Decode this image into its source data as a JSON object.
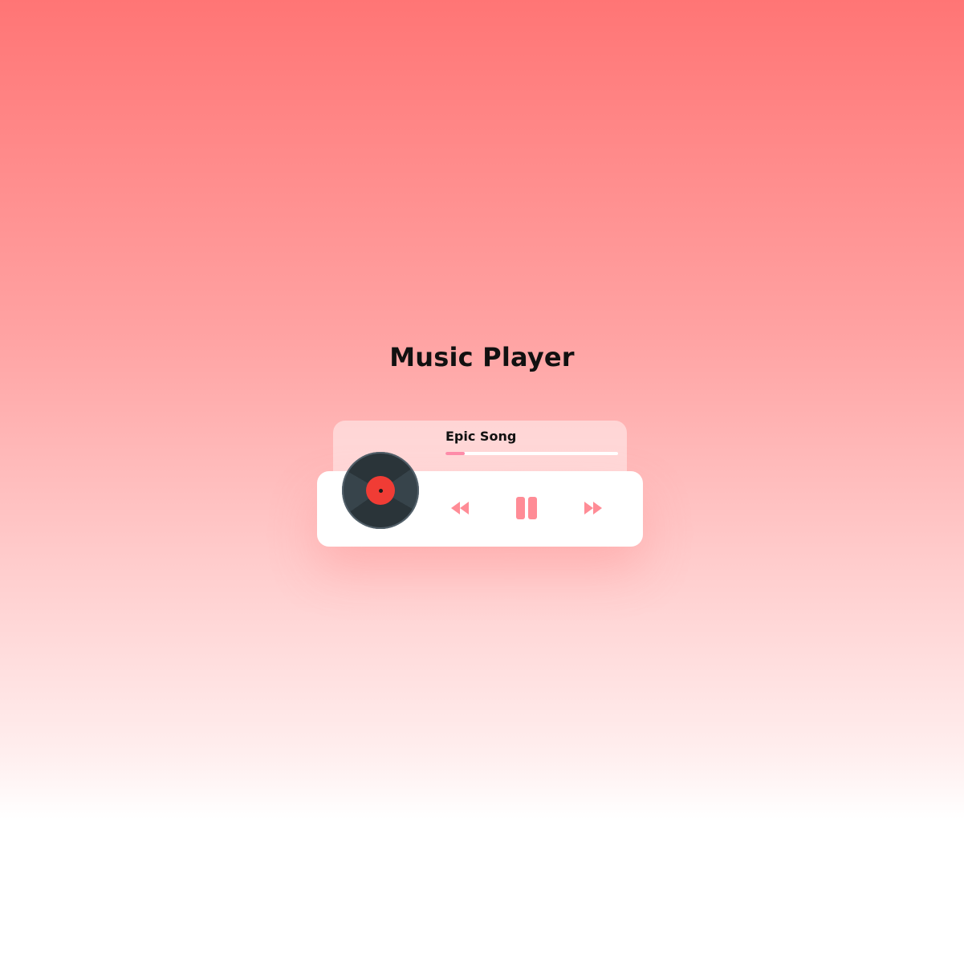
{
  "page": {
    "title": "Music Player"
  },
  "player": {
    "song_title": "Epic Song",
    "progress_percent": 11,
    "state": "playing",
    "controls": {
      "prev_icon": "rewind-icon",
      "pause_icon": "pause-icon",
      "next_icon": "fast-forward-icon"
    },
    "colors": {
      "accent": "#fe8daa",
      "disc_label": "#f03c35",
      "disc": "#2a3439"
    }
  }
}
